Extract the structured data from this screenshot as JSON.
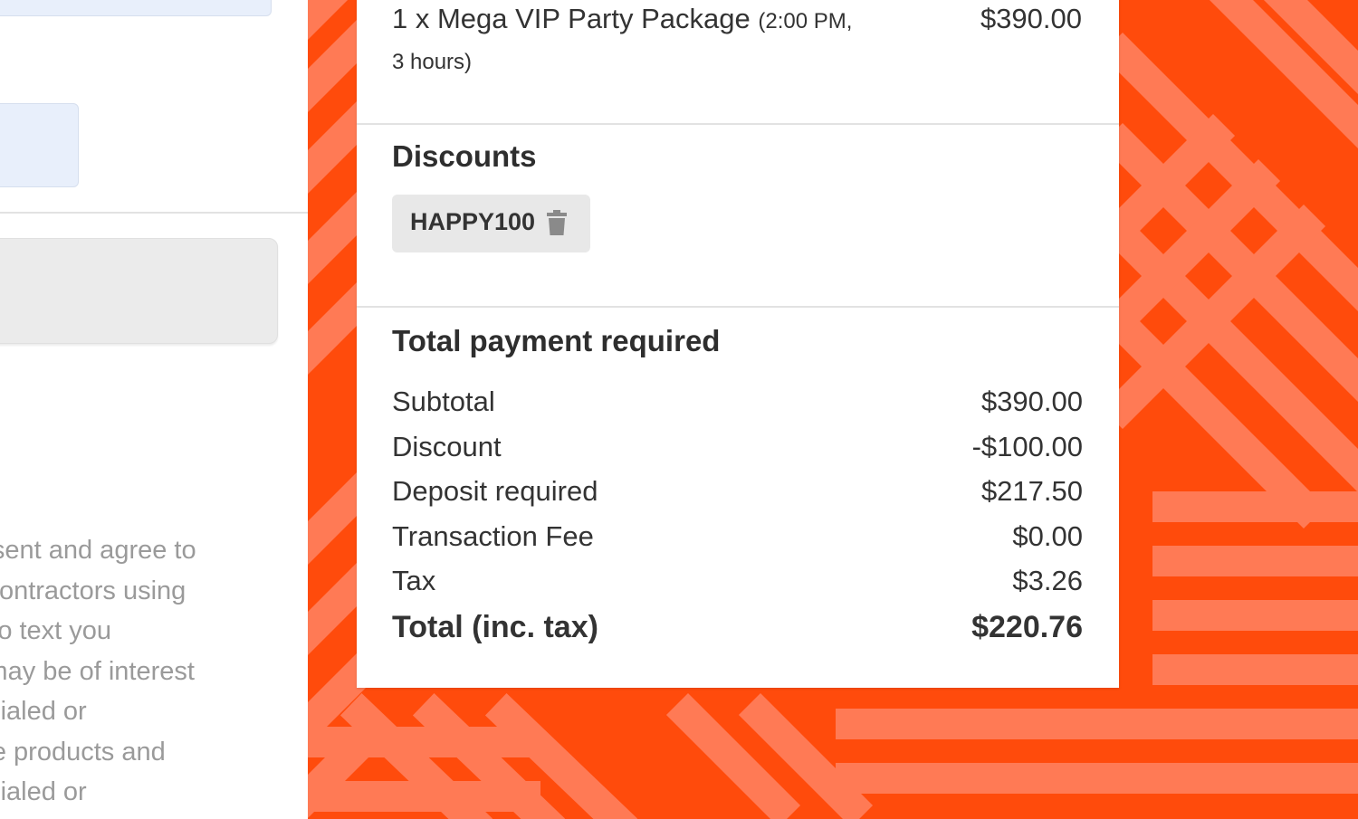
{
  "consent": {
    "lines": [
      "I consent and agree to",
      "and contractors using",
      "LLC to text you",
      "that may be of interest",
      "autodialed or",
      "by the products and",
      "autodialed or"
    ]
  },
  "order": {
    "item": {
      "quantity_name": "1 x Mega VIP Party Package",
      "details": "(2:00 PM, 3 hours)",
      "price": "$390.00"
    },
    "discounts": {
      "heading": "Discounts",
      "code": "HAPPY100",
      "remove_icon": "trash-icon"
    },
    "totals": {
      "heading": "Total payment required",
      "rows": [
        {
          "label": "Subtotal",
          "value": "$390.00"
        },
        {
          "label": "Discount",
          "value": "-$100.00"
        },
        {
          "label": "Deposit required",
          "value": "$217.50"
        },
        {
          "label": "Transaction Fee",
          "value": "$0.00"
        },
        {
          "label": "Tax",
          "value": "$3.26"
        },
        {
          "label": "Total (inc. tax)",
          "value": "$220.76"
        }
      ]
    }
  },
  "colors": {
    "background_orange": "#ff4b0c",
    "stripe_light": "#ff7a55",
    "chip_gray": "#e8e8e8",
    "text_dark": "#333333",
    "consent_gray": "#9a9a9a"
  }
}
